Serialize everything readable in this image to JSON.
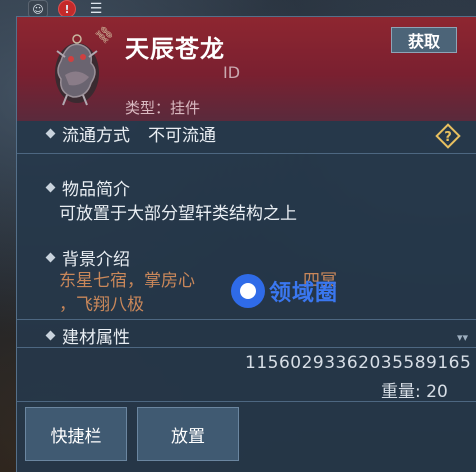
{
  "hud": {
    "alert_label": "!",
    "menu_label": "☰"
  },
  "item": {
    "name": "天辰苍龙",
    "id_label": "ID",
    "type_label": "类型：挂件",
    "get_label": "获取"
  },
  "sections": {
    "circulation_label": "流通方式",
    "circulation_value": "不可流通",
    "summary_title": "物品简介",
    "summary_text": "可放置于大部分望轩类结构之上",
    "lore_title": "背景介绍",
    "lore_line1": "东星七宿，掌房心",
    "lore_line1_tail": "四冥",
    "lore_line2": "，飞翔八极",
    "material_title": "建材属性"
  },
  "watermark": {
    "text": "领域圈"
  },
  "footer": {
    "id_number": "11560293362035589165",
    "weight": "重量: 20",
    "hotbar_label": "快捷栏",
    "place_label": "放置"
  },
  "icons": {
    "item": "dragon-pendant-icon",
    "link": "chain-link-icon",
    "help": "question-diamond-icon",
    "expand": "chevron-down-icon"
  },
  "colors": {
    "header": "#8e2630",
    "panel": "#26384a",
    "lore": "#c9875a",
    "watermark": "#3a77f0"
  }
}
